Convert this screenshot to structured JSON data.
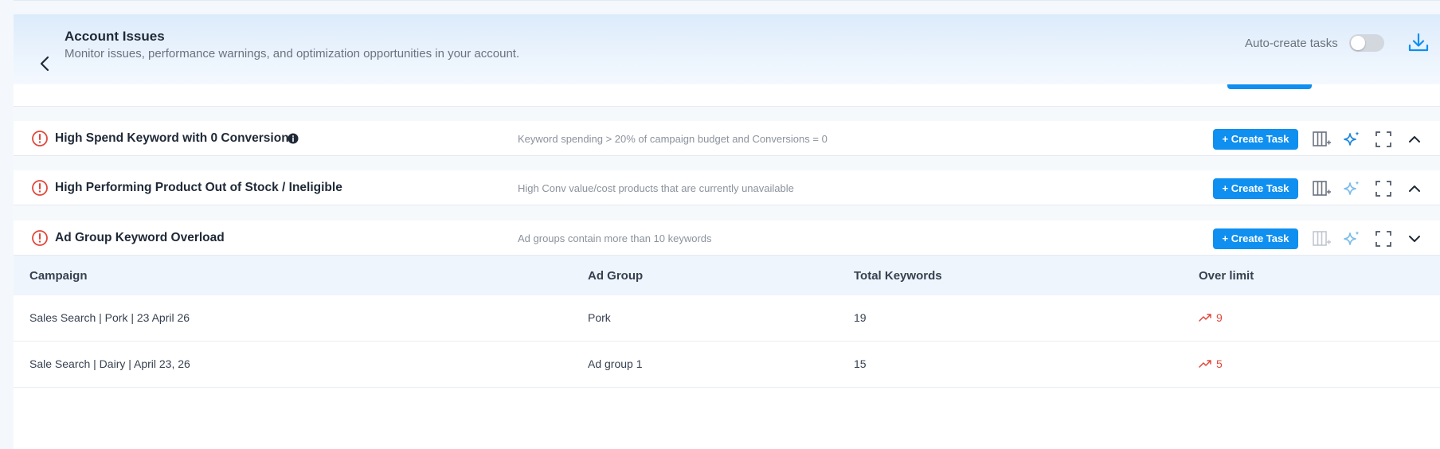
{
  "header": {
    "title": "Account Issues",
    "subtitle": "Monitor issues, performance warnings, and optimization opportunities in your account.",
    "auto_create_label": "Auto-create tasks",
    "auto_create_enabled": false
  },
  "issues": [
    {
      "title": "High Spend Keyword with 0 Conversions",
      "description": "Keyword spending > 20% of campaign budget and Conversions = 0",
      "has_info": true,
      "create_label": "+ Create Task",
      "expanded": false
    },
    {
      "title": "High Performing Product Out of Stock / Ineligible",
      "description": "High Conv value/cost products that are currently unavailable",
      "has_info": false,
      "create_label": "+ Create Task",
      "expanded": false
    },
    {
      "title": "Ad Group Keyword Overload",
      "description": "Ad groups contain more than 10 keywords",
      "has_info": false,
      "create_label": "+ Create Task",
      "expanded": true
    }
  ],
  "table": {
    "headers": [
      "Campaign",
      "Ad Group",
      "Total Keywords",
      "Over limit"
    ],
    "rows": [
      {
        "campaign": "Sales Search | Pork | 23 April 26",
        "ad_group": "Pork",
        "total_keywords": "19",
        "over_limit": "9"
      },
      {
        "campaign": "Sale Search | Dairy | April 23, 26",
        "ad_group": "Ad group 1",
        "total_keywords": "15",
        "over_limit": "5"
      }
    ]
  },
  "icons": {
    "back": "chevron-left-icon",
    "download": "download-icon",
    "warning": "alert-circle-icon",
    "info": "info-icon",
    "columns": "add-column-icon",
    "ai": "sparkles-icon",
    "expand": "fullscreen-icon",
    "collapse": "chevron-up-icon",
    "expand_row": "chevron-down-icon",
    "trend": "trending-up-icon"
  },
  "colors": {
    "accent": "#0f8ff0",
    "warning": "#e0483c",
    "header_gradient_top": "#dcebfb",
    "table_header": "#eef5fc"
  }
}
